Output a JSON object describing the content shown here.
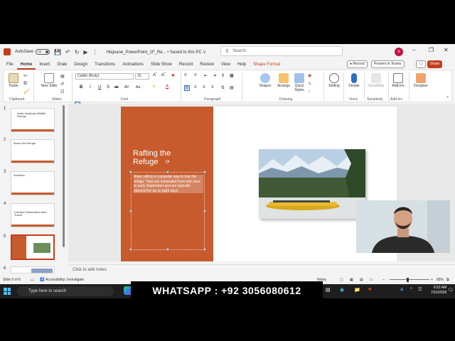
{
  "titlebar": {
    "autosave_label": "AutoSave",
    "autosave_state": "Off",
    "filename": "Hlajoane_PowerPoint_1F_Re...  •  Saved to this PC ∨",
    "search_placeholder": "Search",
    "avatar_initial": "o"
  },
  "tabs": [
    "File",
    "Home",
    "Insert",
    "Draw",
    "Design",
    "Transitions",
    "Animations",
    "Slide Show",
    "Record",
    "Review",
    "View",
    "Help",
    "Shape Format"
  ],
  "tab_buttons": {
    "record": "● Record",
    "present": "Present in Teams",
    "share": "Share"
  },
  "ribbon": {
    "paste": "Paste",
    "new_slide": "New Slide",
    "font_name": "Calibri (Body)",
    "font_size": "15",
    "clipboard": "Clipboard",
    "slides": "Slides",
    "font": "Font",
    "paragraph": "Paragraph",
    "drawing": "Drawing",
    "shapes": "Shapes",
    "arrange": "Arrange",
    "quick_styles": "Quick Styles",
    "editing": "Editing",
    "dictate": "Dictate",
    "sensitivity": "Sensitivity",
    "add_ins": "Add-ins",
    "designer": "Designer",
    "voice": "Voice",
    "sensitivity_grp": "Sensitivity",
    "add_ins_grp": "Add-ins",
    "bold": "B",
    "italic": "I",
    "underline": "U",
    "strike": "S"
  },
  "thumbnails": [
    {
      "num": "1",
      "title": "Ambo National Wildlife Refuge"
    },
    {
      "num": "2",
      "title": "About the Refuge"
    },
    {
      "num": "3",
      "title": "Activities"
    },
    {
      "num": "4",
      "title": "Contact Global Adventure Travel"
    },
    {
      "num": "5",
      "title": ""
    },
    {
      "num": "6",
      "title": ""
    }
  ],
  "slide": {
    "title_line1": "Rafting the",
    "title_line2": "Refuge",
    "body": "River rafting is a popular way to tour the refuge. Trips are scheduled from mid-June to early September and are typically planned for six to eight days."
  },
  "notes_placeholder": "Click to add notes",
  "status": {
    "slide_count": "Slide 5 of 6",
    "accessibility": "Accessibility: Investigate",
    "notes": "Notes",
    "zoom": "65%"
  },
  "taskbar": {
    "search": "Type here to search",
    "time": "6:52 AM",
    "date": "7/15/2026"
  },
  "overlay": "WHATSAPP :  +92 3056080612",
  "colors": {
    "accent": "#c43e1c",
    "slide_orange": "#c75b2d"
  }
}
